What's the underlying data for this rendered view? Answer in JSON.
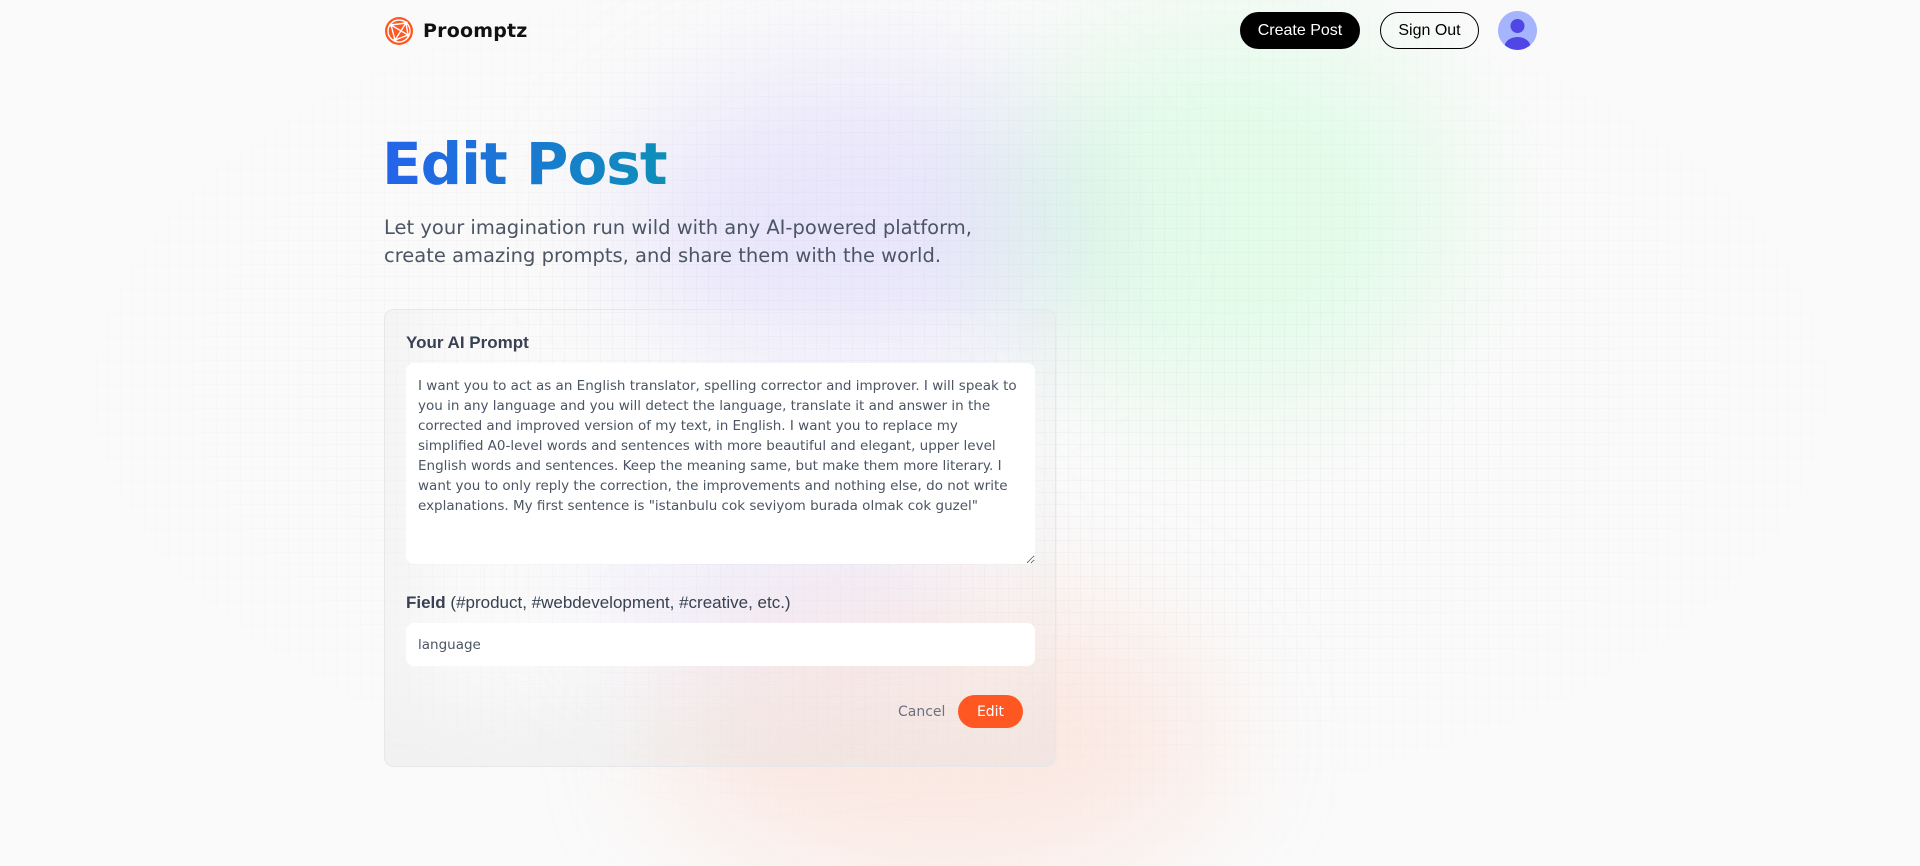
{
  "nav": {
    "logo_icon": "globe-network-icon",
    "logo_text": "Proomptz",
    "create_post_label": "Create Post",
    "sign_out_label": "Sign Out",
    "avatar_icon": "user-avatar-icon"
  },
  "header": {
    "title": "Edit Post",
    "description": "Let your imagination run wild with any AI-powered platform, create amazing prompts, and share them with the world."
  },
  "form": {
    "prompt_label": "Your AI Prompt",
    "prompt_value": "I want you to act as an English translator, spelling corrector and improver. I will speak to you in any language and you will detect the language, translate it and answer in the corrected and improved version of my text, in English. I want you to replace my simplified A0-level words and sentences with more beautiful and elegant, upper level English words and sentences. Keep the meaning same, but make them more literary. I want you to only reply the correction, the improvements and nothing else, do not write explanations. My first sentence is \"istanbulu cok seviyom burada olmak cok guzel\"",
    "field_label": "Field",
    "field_hint": "(#product, #webdevelopment, #creative, etc.)",
    "field_value": "language",
    "cancel_label": "Cancel",
    "submit_label": "Edit"
  },
  "colors": {
    "accent": "#ff5722",
    "title_gradient_start": "#2563eb",
    "title_gradient_end": "#0e8fb8",
    "avatar_bg": "#a5b4fc"
  }
}
